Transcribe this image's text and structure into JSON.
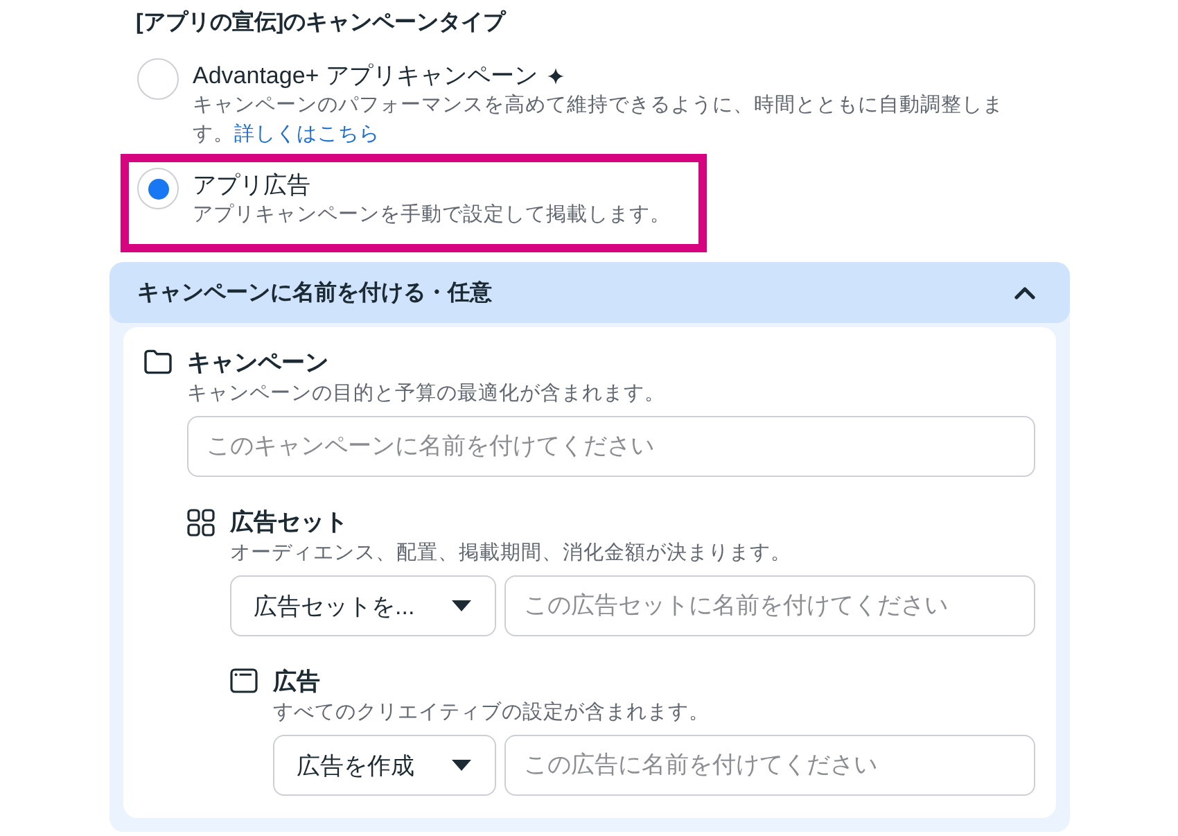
{
  "campaign_type": {
    "heading": "[アプリの宣伝]のキャンペーンタイプ",
    "options": [
      {
        "kind": "advantage",
        "title": "Advantage+ アプリキャンペーン",
        "description": "キャンペーンのパフォーマンスを高めて維持できるように、時間とともに自動調整します。",
        "link": "詳しくはこちら",
        "selected": false,
        "highlighted": false
      },
      {
        "kind": "manual",
        "title": "アプリ広告",
        "description": "アプリキャンペーンを手動で設定して掲載します。",
        "selected": true,
        "highlighted": true
      }
    ]
  },
  "naming_section": {
    "title": "キャンペーンに名前を付ける・任意",
    "expanded": true,
    "levels": [
      {
        "kind": "campaign",
        "title": "キャンペーン",
        "description": "キャンペーンの目的と予算の最適化が含まれます。",
        "name_field": {
          "placeholder": "このキャンペーンに名前を付けてください"
        },
        "children": [
          {
            "kind": "ad_set",
            "title": "広告セット",
            "description": "オーディエンス、配置、掲載期間、消化金額が決まります。",
            "dropdown": {
              "value": "広告セットを..."
            },
            "name_field": {
              "placeholder": "この広告セットに名前を付けてください"
            },
            "children": [
              {
                "kind": "ad",
                "title": "広告",
                "description": "すべてのクリエイティブの設定が含まれます。",
                "dropdown": {
                  "value": "広告を作成"
                },
                "name_field": {
                  "placeholder": "この広告に名前を付けてください"
                }
              }
            ]
          }
        ]
      }
    ]
  }
}
